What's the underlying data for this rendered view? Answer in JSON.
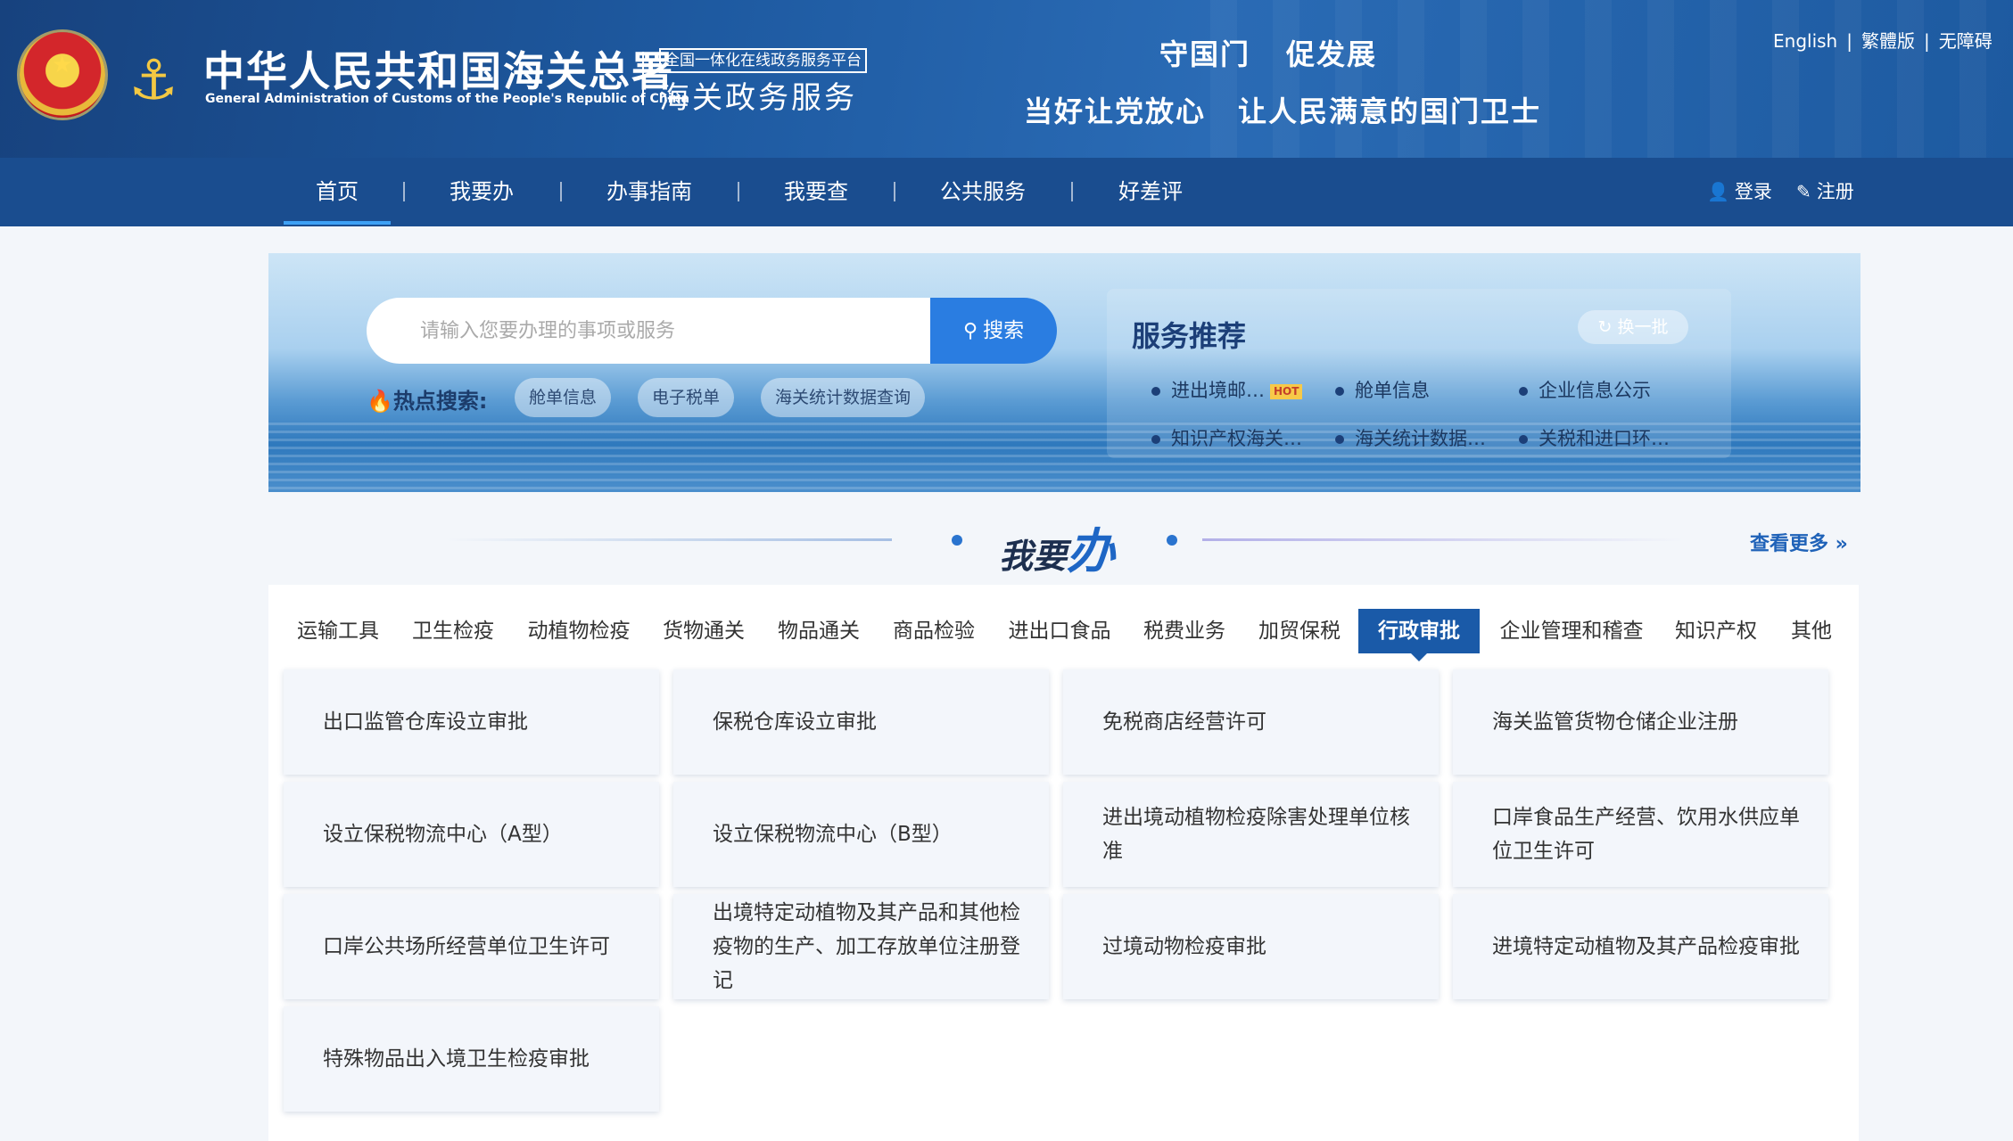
{
  "header": {
    "site_title_cn": "中华人民共和国海关总署",
    "site_title_en": "General Administration of Customs of the People's Republic of China",
    "platform_badge": "全国一体化在线政务服务平台",
    "platform_name": "海关政务服务",
    "slogan_line1": [
      "守国门",
      "促发展"
    ],
    "slogan_line2": [
      "当好让党放心",
      "让人民满意的国门卫士"
    ],
    "lang_links": [
      "English",
      "繁體版",
      "无障碍"
    ],
    "lang_separator": "|"
  },
  "nav": {
    "items": [
      "首页",
      "我要办",
      "办事指南",
      "我要查",
      "公共服务",
      "好差评"
    ],
    "active_index": 0,
    "login": "登录",
    "register": "注册"
  },
  "search": {
    "placeholder": "请输入您要办理的事项或服务",
    "button": "搜索",
    "hot_label": "热点搜索:",
    "hot_tags": [
      "舱单信息",
      "电子税单",
      "海关统计数据查询"
    ]
  },
  "recommend": {
    "title": "服务推荐",
    "refresh": "换一批",
    "hot_badge": "HOT",
    "items": [
      "进出境邮…",
      "舱单信息",
      "企业信息公示",
      "知识产权海关…",
      "海关统计数据…",
      "关税和进口环…"
    ]
  },
  "section": {
    "title_prefix": "我要",
    "title_big": "办",
    "more": "查看更多"
  },
  "tabs": {
    "items": [
      "运输工具",
      "卫生检疫",
      "动植物检疫",
      "货物通关",
      "物品通关",
      "商品检验",
      "进出口食品",
      "税费业务",
      "加贸保税",
      "行政审批",
      "企业管理和稽查",
      "知识产权",
      "其他"
    ],
    "active_index": 9
  },
  "cards": [
    "出口监管仓库设立审批",
    "保税仓库设立审批",
    "免税商店经营许可",
    "海关监管货物仓储企业注册",
    "设立保税物流中心（A型）",
    "设立保税物流中心（B型）",
    "进出境动植物检疫除害处理单位核准",
    "口岸食品生产经营、饮用水供应单位卫生许可",
    "口岸公共场所经营单位卫生许可",
    "出境特定动植物及其产品和其他检疫物的生产、加工存放单位注册登记",
    "过境动物检疫审批",
    "进境特定动植物及其产品检疫审批",
    "特殊物品出入境卫生检疫审批"
  ],
  "colors": {
    "header_blue": "#1e5aa1",
    "nav_blue": "#1a4d8f",
    "accent_blue": "#2a7de1",
    "active_tab": "#1a5aa8"
  }
}
